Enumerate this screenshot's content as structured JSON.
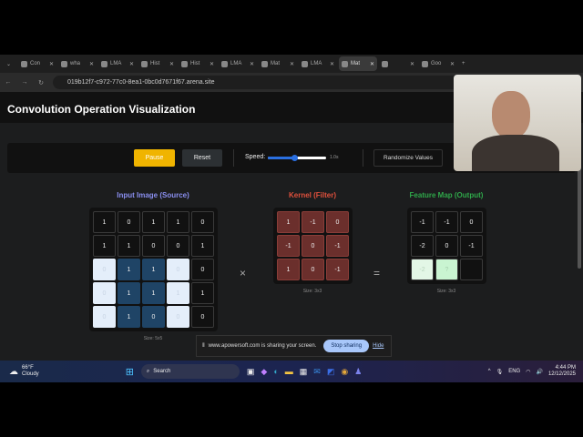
{
  "browser": {
    "tabs": [
      {
        "label": "Con"
      },
      {
        "label": "wha"
      },
      {
        "label": "LMA"
      },
      {
        "label": "Hist"
      },
      {
        "label": "Hist"
      },
      {
        "label": "LMA"
      },
      {
        "label": "Mat"
      },
      {
        "label": "LMA"
      },
      {
        "label": "Mat",
        "active": true
      },
      {
        "label": ""
      },
      {
        "label": "Goo"
      }
    ],
    "url": "019b12f7-c972-77c0-8ea1-0bc0d7671f67.arena.site"
  },
  "page": {
    "title": "Convolution Operation Visualization",
    "controls": {
      "pause": "Pause",
      "reset": "Reset",
      "speed_label": "Speed:",
      "speed_value": "1.0s",
      "speed_fraction": 0.45,
      "randomize": "Randomize Values"
    },
    "input": {
      "title": "Input Image (Source)",
      "size": "Size: 5x5",
      "rows": [
        [
          "1",
          "0",
          "1",
          "1",
          "0"
        ],
        [
          "1",
          "1",
          "0",
          "0",
          "1"
        ],
        [
          "0",
          "1",
          "1",
          "0",
          "0"
        ],
        [
          "0",
          "1",
          "1",
          "1",
          "1"
        ],
        [
          "0",
          "1",
          "0",
          "0",
          "0"
        ]
      ]
    },
    "kernel": {
      "title": "Kernel (Filter)",
      "size": "Size: 3x3",
      "rows": [
        [
          "1",
          "-1",
          "0"
        ],
        [
          "-1",
          "0",
          "-1"
        ],
        [
          "1",
          "0",
          "-1"
        ]
      ]
    },
    "output": {
      "title": "Feature Map (Output)",
      "size": "Size: 3x3",
      "rows": [
        [
          "-1",
          "-1",
          "0"
        ],
        [
          "-2",
          "0",
          "-1"
        ],
        [
          "-2",
          "?",
          ""
        ]
      ]
    },
    "times": "×",
    "equals": "=",
    "colors": {
      "input_title": "#8a8ff0",
      "kernel_title": "#e0503c",
      "output_title": "#2fa84a",
      "pause": "#f0b400"
    }
  },
  "share_bar": {
    "text": "www.apowersoft.com is sharing your screen.",
    "stop": "Stop sharing",
    "hide": "Hide"
  },
  "taskbar": {
    "weather_temp": "66°F",
    "weather_desc": "Cloudy",
    "search": "Search",
    "lang": "ENG",
    "time": "4:44 PM",
    "date": "12/12/2025"
  }
}
